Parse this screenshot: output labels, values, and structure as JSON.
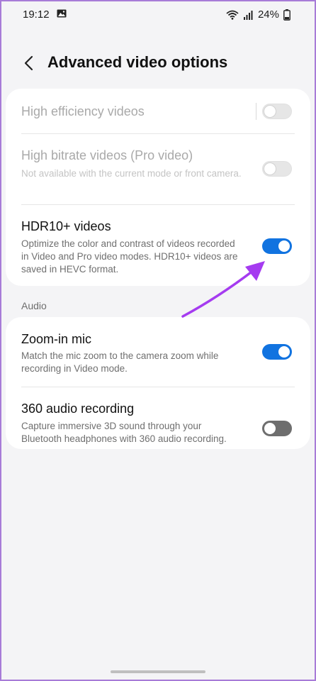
{
  "status_bar": {
    "time": "19:12",
    "battery": "24%"
  },
  "header": {
    "title": "Advanced video options"
  },
  "video_settings": {
    "high_efficiency": {
      "title": "High efficiency videos",
      "enabled": false,
      "available": false
    },
    "high_bitrate": {
      "title": "High bitrate videos (Pro video)",
      "description": "Not available with the current mode or front camera.",
      "enabled": false,
      "available": false
    },
    "hdr10": {
      "title": "HDR10+ videos",
      "description": "Optimize the color and contrast of videos recorded in Video and Pro video modes. HDR10+ videos are saved in HEVC format.",
      "enabled": true,
      "available": true
    }
  },
  "audio_section": {
    "label": "Audio",
    "zoom_in_mic": {
      "title": "Zoom-in mic",
      "description": "Match the mic zoom to the camera zoom while recording in Video mode.",
      "enabled": true
    },
    "audio_360": {
      "title": "360 audio recording",
      "description": "Capture immersive 3D sound through your Bluetooth headphones with 360 audio recording.",
      "enabled": false
    }
  },
  "colors": {
    "toggle_on": "#1173e0",
    "annotation_arrow": "#a53bf0",
    "frame_border": "#a77bd8"
  }
}
